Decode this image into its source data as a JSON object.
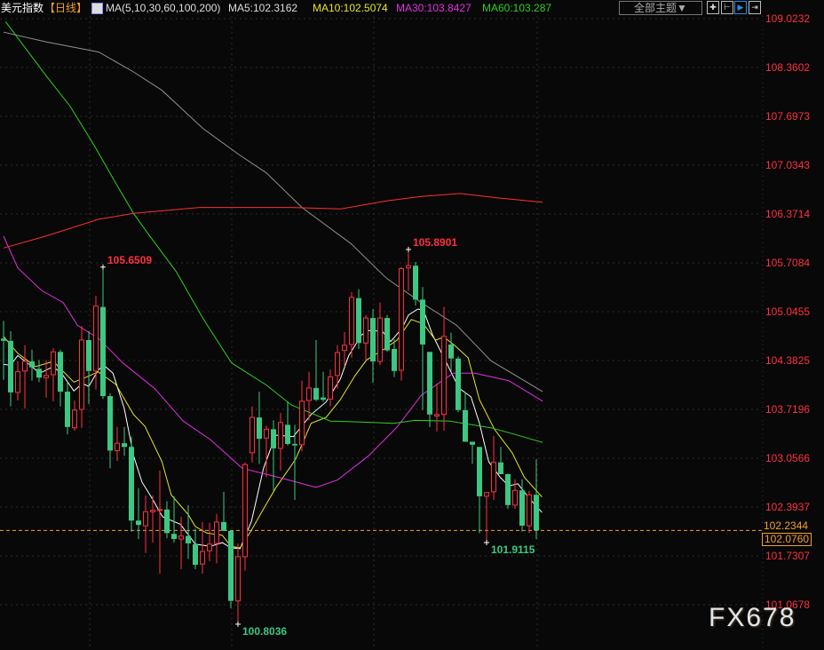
{
  "header": {
    "instrument": "美元指数",
    "period": "【日线】",
    "indicator": "MA(5,10,30,60,100,200)",
    "ma5": "MA5:102.3162",
    "ma10": "MA10:102.5074",
    "ma30": "MA30:103.8427",
    "ma60": "MA60:103.287",
    "theme_button": "全部主题▼",
    "tool_icons": [
      "crosshair-icon",
      "zoom-range-icon",
      "play-icon",
      "goto-end-icon"
    ]
  },
  "watermark": "FX678",
  "colors": {
    "up": "#ff3040",
    "down": "#3cc882",
    "ma5": "#ffffff",
    "ma10": "#e6e62a",
    "ma30": "#e030e0",
    "ma60": "#30d020",
    "ma100": "#909090",
    "ma200": "#ff3030",
    "axis_text": "#ff3040",
    "current_price": "#f0a030"
  },
  "chart_data": {
    "type": "candlestick",
    "ylim": [
      101.0678,
      109.0232
    ],
    "y_ticks": [
      "109.0232",
      "108.3602",
      "107.6973",
      "107.0343",
      "106.3714",
      "105.7084",
      "105.0455",
      "104.3825",
      "103.7196",
      "103.0566",
      "102.3937",
      "101.7307",
      "101.0678"
    ],
    "grid": true,
    "current_price": "102.0760",
    "current_ma_marker": "102.2344",
    "extremes": [
      {
        "label": "105.6509",
        "index": 14,
        "value": 105.6509,
        "kind": "high"
      },
      {
        "label": "105.8901",
        "index": 57,
        "value": 105.8901,
        "kind": "high"
      },
      {
        "label": "101.9115",
        "index": 68,
        "value": 101.9115,
        "kind": "low"
      },
      {
        "label": "100.8036",
        "index": 33,
        "value": 100.8036,
        "kind": "low"
      }
    ],
    "ohlc": [
      [
        104.68,
        104.92,
        104.12,
        104.65
      ],
      [
        104.65,
        104.78,
        103.76,
        103.95
      ],
      [
        103.95,
        104.37,
        103.84,
        104.23
      ],
      [
        104.24,
        104.59,
        103.73,
        104.37
      ],
      [
        104.37,
        104.53,
        104.11,
        104.29
      ],
      [
        104.27,
        104.39,
        104.09,
        104.15
      ],
      [
        104.15,
        104.39,
        103.88,
        104.18
      ],
      [
        104.19,
        104.55,
        103.83,
        104.5
      ],
      [
        104.5,
        104.53,
        103.76,
        103.96
      ],
      [
        103.96,
        104.09,
        103.38,
        103.48
      ],
      [
        103.47,
        103.84,
        103.43,
        103.71
      ],
      [
        103.72,
        104.85,
        103.47,
        104.66
      ],
      [
        104.66,
        104.78,
        103.79,
        104.24
      ],
      [
        104.24,
        105.26,
        103.99,
        105.12
      ],
      [
        105.11,
        105.6509,
        103.86,
        103.9
      ],
      [
        103.9,
        103.94,
        102.92,
        103.16
      ],
      [
        103.16,
        103.48,
        103.02,
        103.26
      ],
      [
        103.26,
        103.48,
        103.09,
        103.21
      ],
      [
        103.21,
        103.35,
        102.06,
        102.21
      ],
      [
        102.21,
        102.65,
        101.96,
        102.15
      ],
      [
        102.14,
        102.55,
        101.77,
        102.33
      ],
      [
        102.33,
        102.55,
        101.91,
        102.35
      ],
      [
        102.35,
        102.89,
        101.49,
        102.36
      ],
      [
        102.36,
        102.47,
        101.97,
        102.04
      ],
      [
        102.03,
        102.54,
        101.91,
        101.96
      ],
      [
        101.96,
        102.26,
        101.55,
        102.0
      ],
      [
        102.0,
        102.42,
        101.69,
        101.9
      ],
      [
        101.89,
        102.1,
        101.55,
        101.61
      ],
      [
        101.62,
        102.19,
        101.49,
        101.79
      ],
      [
        101.8,
        102.18,
        101.66,
        101.89
      ],
      [
        101.9,
        102.3,
        101.63,
        102.19
      ],
      [
        102.19,
        102.6,
        102.07,
        102.07
      ],
      [
        102.07,
        102.07,
        101.02,
        101.12
      ],
      [
        101.12,
        101.9,
        100.8036,
        101.72
      ],
      [
        101.72,
        103.0,
        101.53,
        102.97
      ],
      [
        103.13,
        103.76,
        103.0,
        103.61
      ],
      [
        103.61,
        103.96,
        102.98,
        103.32
      ],
      [
        103.33,
        103.5,
        102.8,
        103.45
      ],
      [
        103.45,
        103.57,
        102.62,
        103.19
      ],
      [
        103.19,
        103.67,
        102.89,
        103.54
      ],
      [
        103.51,
        103.83,
        103.23,
        103.25
      ],
      [
        103.25,
        103.51,
        102.49,
        103.23
      ],
      [
        103.24,
        104.11,
        103.15,
        103.83
      ],
      [
        103.84,
        104.23,
        103.57,
        104.01
      ],
      [
        104.01,
        104.66,
        103.83,
        103.85
      ],
      [
        103.88,
        104.23,
        103.82,
        103.85
      ],
      [
        103.86,
        104.26,
        103.76,
        104.16
      ],
      [
        104.18,
        104.59,
        104.0,
        104.49
      ],
      [
        104.52,
        104.77,
        104.3,
        104.59
      ],
      [
        104.6,
        105.31,
        104.42,
        105.24
      ],
      [
        105.23,
        105.35,
        104.54,
        104.62
      ],
      [
        104.62,
        105.0,
        104.39,
        104.96
      ],
      [
        104.96,
        105.08,
        104.08,
        104.37
      ],
      [
        104.37,
        105.17,
        104.32,
        104.96
      ],
      [
        104.96,
        105.0,
        104.5,
        104.52
      ],
      [
        104.54,
        104.67,
        104.16,
        104.24
      ],
      [
        104.25,
        105.65,
        104.11,
        105.63
      ],
      [
        105.64,
        105.8901,
        105.33,
        105.67
      ],
      [
        105.67,
        105.72,
        105.13,
        105.21
      ],
      [
        105.21,
        105.38,
        103.71,
        104.6
      ],
      [
        104.5,
        104.5,
        103.48,
        103.65
      ],
      [
        103.63,
        104.07,
        103.42,
        103.65
      ],
      [
        103.65,
        105.11,
        103.43,
        104.71
      ],
      [
        104.6,
        104.76,
        104.24,
        104.41
      ],
      [
        104.41,
        104.44,
        103.68,
        103.71
      ],
      [
        103.71,
        103.95,
        103.28,
        103.28
      ],
      [
        103.28,
        103.28,
        102.98,
        103.24
      ],
      [
        103.21,
        103.21,
        102.04,
        102.54
      ],
      [
        102.54,
        102.59,
        101.9115,
        102.59
      ],
      [
        102.6,
        103.36,
        102.49,
        103.0
      ],
      [
        103.0,
        103.21,
        102.84,
        102.84
      ],
      [
        102.84,
        102.85,
        102.37,
        102.42
      ],
      [
        102.42,
        102.77,
        102.37,
        102.62
      ],
      [
        102.62,
        102.77,
        102.06,
        102.14
      ],
      [
        102.14,
        102.61,
        102.04,
        102.56
      ],
      [
        102.56,
        103.04,
        101.96,
        102.076
      ]
    ],
    "series": [
      {
        "name": "MA5",
        "color": "#ffffff",
        "points": [
          [
            0,
            104.33
          ],
          [
            1,
            104.32
          ],
          [
            2,
            104.45
          ],
          [
            3.6,
            104.33
          ],
          [
            5.1,
            104.21
          ],
          [
            7,
            104.3
          ],
          [
            8.3,
            104.19
          ],
          [
            9.9,
            103.97
          ],
          [
            11.1,
            104.07
          ],
          [
            12,
            104.03
          ],
          [
            13.3,
            104.25
          ],
          [
            14.1,
            104.32
          ],
          [
            15.4,
            104.21
          ],
          [
            17,
            103.73
          ],
          [
            18.3,
            103.09
          ],
          [
            19.5,
            102.73
          ],
          [
            20.8,
            102.53
          ],
          [
            22.4,
            102.26
          ],
          [
            24.9,
            102.16
          ],
          [
            27,
            101.89
          ],
          [
            29.1,
            101.86
          ],
          [
            30.8,
            101.91
          ],
          [
            32,
            101.84
          ],
          [
            33.3,
            101.83
          ],
          [
            34.9,
            102.2
          ],
          [
            36.6,
            102.92
          ],
          [
            38.3,
            103.37
          ],
          [
            40.8,
            103.35
          ],
          [
            43.3,
            103.65
          ],
          [
            45.4,
            103.82
          ],
          [
            47.4,
            104.13
          ],
          [
            48.6,
            104.45
          ],
          [
            50.4,
            104.73
          ],
          [
            51.4,
            104.79
          ],
          [
            53.3,
            104.78
          ],
          [
            54.5,
            104.64
          ],
          [
            56.1,
            104.82
          ],
          [
            57,
            105.0
          ],
          [
            58.3,
            105.08
          ],
          [
            59.1,
            105.07
          ],
          [
            60.4,
            104.73
          ],
          [
            62,
            104.42
          ],
          [
            64.1,
            104.01
          ],
          [
            65.8,
            103.89
          ],
          [
            67,
            103.53
          ],
          [
            68.3,
            103.01
          ],
          [
            69.9,
            102.8
          ],
          [
            71.1,
            102.68
          ],
          [
            72.4,
            102.71
          ],
          [
            74.1,
            102.5
          ],
          [
            75.8,
            102.32
          ]
        ]
      },
      {
        "name": "MA10",
        "color": "#e6e62a",
        "points": [
          [
            0,
            104.71
          ],
          [
            2,
            104.48
          ],
          [
            4.5,
            104.3
          ],
          [
            7,
            104.37
          ],
          [
            9.9,
            104.09
          ],
          [
            12,
            104.17
          ],
          [
            13.3,
            104.23
          ],
          [
            15.8,
            104.06
          ],
          [
            18.3,
            103.65
          ],
          [
            19.9,
            103.49
          ],
          [
            22.3,
            103.01
          ],
          [
            23.6,
            102.56
          ],
          [
            26,
            102.29
          ],
          [
            27,
            102.13
          ],
          [
            28.6,
            102.04
          ],
          [
            30.8,
            102.01
          ],
          [
            32,
            101.86
          ],
          [
            33.3,
            101.84
          ],
          [
            34.9,
            102.08
          ],
          [
            36.6,
            102.37
          ],
          [
            38.3,
            102.65
          ],
          [
            41.1,
            103.04
          ],
          [
            43.3,
            103.53
          ],
          [
            45.4,
            103.61
          ],
          [
            47.4,
            103.85
          ],
          [
            49.5,
            104.18
          ],
          [
            51.1,
            104.39
          ],
          [
            53.6,
            104.54
          ],
          [
            55.4,
            104.66
          ],
          [
            57.4,
            104.94
          ],
          [
            59.1,
            104.88
          ],
          [
            60.8,
            104.66
          ],
          [
            62,
            104.7
          ],
          [
            63.6,
            104.58
          ],
          [
            65.4,
            104.42
          ],
          [
            67,
            103.85
          ],
          [
            69.1,
            103.45
          ],
          [
            71.6,
            103.13
          ],
          [
            73.3,
            102.8
          ],
          [
            75.8,
            102.53
          ]
        ]
      },
      {
        "name": "MA30",
        "color": "#e030e0",
        "points": [
          [
            0,
            106.07
          ],
          [
            2,
            105.64
          ],
          [
            5.4,
            105.33
          ],
          [
            8.4,
            105.17
          ],
          [
            10.4,
            104.86
          ],
          [
            13.4,
            104.68
          ],
          [
            16.8,
            104.35
          ],
          [
            21.3,
            104.0
          ],
          [
            25.3,
            103.56
          ],
          [
            29.1,
            103.31
          ],
          [
            33.6,
            102.92
          ],
          [
            39,
            102.79
          ],
          [
            44,
            102.66
          ],
          [
            47,
            102.76
          ],
          [
            51.4,
            103.09
          ],
          [
            55.4,
            103.48
          ],
          [
            58.8,
            103.91
          ],
          [
            63.3,
            104.21
          ],
          [
            66.3,
            104.21
          ],
          [
            71.1,
            104.11
          ],
          [
            75.9,
            103.83
          ]
        ]
      },
      {
        "name": "MA60",
        "color": "#30d020",
        "points": [
          [
            0.3,
            108.98
          ],
          [
            5.9,
            108.26
          ],
          [
            9.4,
            107.83
          ],
          [
            12.9,
            107.28
          ],
          [
            15.8,
            106.79
          ],
          [
            18.3,
            106.38
          ],
          [
            20.3,
            106.11
          ],
          [
            24.3,
            105.59
          ],
          [
            28.1,
            104.95
          ],
          [
            32.1,
            104.35
          ],
          [
            37,
            104.05
          ],
          [
            40.5,
            103.78
          ],
          [
            46,
            103.56
          ],
          [
            49.9,
            103.55
          ],
          [
            54.9,
            103.53
          ],
          [
            57.9,
            103.57
          ],
          [
            62.8,
            103.56
          ],
          [
            68.6,
            103.47
          ],
          [
            71.6,
            103.39
          ],
          [
            75.9,
            103.27
          ]
        ]
      },
      {
        "name": "MA100",
        "color": "#909090",
        "points": [
          [
            0,
            108.84
          ],
          [
            5.9,
            108.71
          ],
          [
            13.4,
            108.57
          ],
          [
            18.3,
            108.3
          ],
          [
            22.3,
            108.05
          ],
          [
            28.1,
            107.53
          ],
          [
            33.1,
            107.18
          ],
          [
            37,
            106.93
          ],
          [
            42,
            106.46
          ],
          [
            48.9,
            105.97
          ],
          [
            53.9,
            105.5
          ],
          [
            58.8,
            105.17
          ],
          [
            63.8,
            104.86
          ],
          [
            68.6,
            104.38
          ],
          [
            75.9,
            103.96
          ]
        ]
      },
      {
        "name": "MA200",
        "color": "#ff3030",
        "points": [
          [
            0,
            105.91
          ],
          [
            5.9,
            106.07
          ],
          [
            13.4,
            106.3
          ],
          [
            18.3,
            106.38
          ],
          [
            27.6,
            106.46
          ],
          [
            40.5,
            106.46
          ],
          [
            47.5,
            106.44
          ],
          [
            53.9,
            106.55
          ],
          [
            58.8,
            106.61
          ],
          [
            64.3,
            106.65
          ],
          [
            69.6,
            106.59
          ],
          [
            75.9,
            106.53
          ]
        ]
      }
    ]
  }
}
